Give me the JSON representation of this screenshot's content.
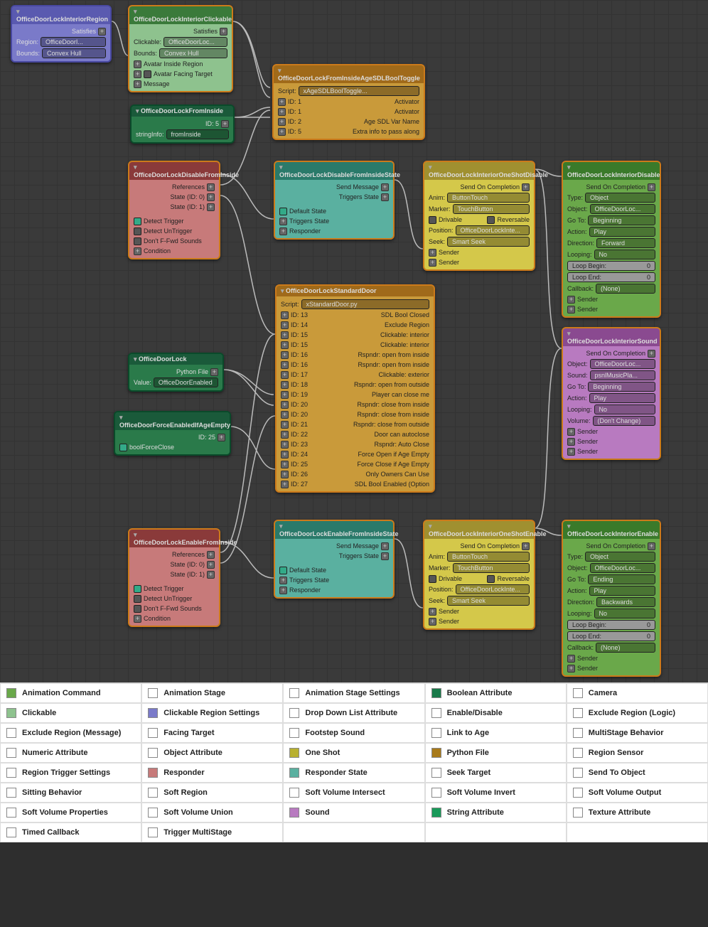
{
  "nodes": {
    "region": {
      "title": "OfficeDoorLockInteriorRegion",
      "satisfies": "Satisfies",
      "region_lbl": "Region:",
      "region_val": "OfficeDoorI...",
      "bounds_lbl": "Bounds:",
      "bounds_val": "Convex Hull"
    },
    "clickable": {
      "title": "OfficeDoorLockInteriorClickable",
      "satisfies": "Satisfies",
      "click_lbl": "Clickable:",
      "click_val": "OfficeDoorLoc...",
      "bounds_lbl": "Bounds:",
      "bounds_val": "Convex Hull",
      "avatar_inside": "Avatar Inside Region",
      "avatar_facing": "Avatar Facing Target",
      "message": "Message"
    },
    "fromInside": {
      "title": "OfficeDoorLockFromInside",
      "id_lbl": "ID: 5",
      "string_lbl": "stringInfo:",
      "string_val": "fromInside"
    },
    "ageToggle": {
      "title": "OfficeDoorLockFromInsideAgeSDLBoolToggle",
      "script_lbl": "Script:",
      "script_val": "xAgeSDLBoolToggle...",
      "rows": [
        {
          "id": "ID: 1",
          "txt": "Activator"
        },
        {
          "id": "ID: 1",
          "txt": "Activator"
        },
        {
          "id": "ID: 2",
          "txt": "Age SDL Var Name"
        },
        {
          "id": "ID: 5",
          "txt": "Extra info to pass along"
        }
      ]
    },
    "disable": {
      "title": "OfficeDoorLockDisableFromInside",
      "refs": "References",
      "s0": "State (ID: 0)",
      "s1": "State (ID: 1)",
      "det_trig": "Detect Trigger",
      "det_untrig": "Detect UnTrigger",
      "ffwd": "Don't F-Fwd Sounds",
      "cond": "Condition"
    },
    "disableState": {
      "title": "OfficeDoorLockDisableFromInsideState",
      "send": "Send Message",
      "trig": "Triggers State",
      "def": "Default State",
      "trig2": "Triggers State",
      "resp": "Responder"
    },
    "oneshotD": {
      "title": "OfficeDoorLockInteriorOneShotDisable",
      "comp": "Send On Completion",
      "anim_lbl": "Anim:",
      "anim_val": "ButtonTouch",
      "mark_lbl": "Marker:",
      "mark_val": "TouchButton",
      "driv": "Drivable",
      "rev": "Reversable",
      "pos_lbl": "Position:",
      "pos_val": "OfficeDoorLockInte...",
      "seek_lbl": "Seek:",
      "seek_val": "Smart Seek",
      "sender": "Sender"
    },
    "intDisable": {
      "title": "OfficeDoorLockInteriorDisable",
      "comp": "Send On Completion",
      "type_lbl": "Type:",
      "type_val": "Object",
      "obj_lbl": "Object:",
      "obj_val": "OfficeDoorLoc...",
      "goto_lbl": "Go To:",
      "goto_val": "Beginning",
      "act_lbl": "Action:",
      "act_val": "Play",
      "dir_lbl": "Direction:",
      "dir_val": "Forward",
      "loop_lbl": "Looping:",
      "loop_val": "No",
      "lb_lbl": "Loop Begin:",
      "lb_val": "0",
      "le_lbl": "Loop End:",
      "le_val": "0",
      "cb_lbl": "Callback:",
      "cb_val": "(None)",
      "sender": "Sender"
    },
    "lock": {
      "title": "OfficeDoorLock",
      "py": "Python File",
      "val_lbl": "Value:",
      "val": "OfficeDoorEnabled"
    },
    "forceEn": {
      "title": "OfficeDoorForceEnabledIfAgeEmpty",
      "id": "ID: 25",
      "bfc": "boolForceClose"
    },
    "stdDoor": {
      "title": "OfficeDoorLockStandardDoor",
      "script_lbl": "Script:",
      "script_val": "xStandardDoor.py",
      "rows": [
        {
          "id": "ID: 13",
          "txt": "SDL Bool Closed"
        },
        {
          "id": "ID: 14",
          "txt": "Exclude Region"
        },
        {
          "id": "ID: 15",
          "txt": "Clickable: interior"
        },
        {
          "id": "ID: 15",
          "txt": "Clickable: interior"
        },
        {
          "id": "ID: 16",
          "txt": "Rspndr: open from inside"
        },
        {
          "id": "ID: 16",
          "txt": "Rspndr: open from inside"
        },
        {
          "id": "ID: 17",
          "txt": "Clickable: exterior"
        },
        {
          "id": "ID: 18",
          "txt": "Rspndr: open from outside"
        },
        {
          "id": "ID: 19",
          "txt": "Player can close me"
        },
        {
          "id": "ID: 20",
          "txt": "Rspndr: close from inside"
        },
        {
          "id": "ID: 20",
          "txt": "Rspndr: close from inside"
        },
        {
          "id": "ID: 21",
          "txt": "Rspndr: close from outside"
        },
        {
          "id": "ID: 22",
          "txt": "Door can autoclose"
        },
        {
          "id": "ID: 23",
          "txt": "Rspndr: Auto Close"
        },
        {
          "id": "ID: 24",
          "txt": "Force Open if Age Empty"
        },
        {
          "id": "ID: 25",
          "txt": "Force Close if Age Empty"
        },
        {
          "id": "ID: 26",
          "txt": "Only Owners Can Use"
        },
        {
          "id": "ID: 27",
          "txt": "SDL Bool Enabled (Option"
        }
      ]
    },
    "enable": {
      "title": "OfficeDoorLockEnableFromInside",
      "refs": "References",
      "s0": "State (ID: 0)",
      "s1": "State (ID: 1)",
      "det_trig": "Detect Trigger",
      "det_untrig": "Detect UnTrigger",
      "ffwd": "Don't F-Fwd Sounds",
      "cond": "Condition"
    },
    "enableState": {
      "title": "OfficeDoorLockEnableFromInsideState",
      "send": "Send Message",
      "trig": "Triggers State",
      "def": "Default State",
      "trig2": "Triggers State",
      "resp": "Responder"
    },
    "oneshotE": {
      "title": "OfficeDoorLockInteriorOneShotEnable",
      "comp": "Send On Completion",
      "anim_lbl": "Anim:",
      "anim_val": "ButtonTouch",
      "mark_lbl": "Marker:",
      "mark_val": "TouchButton",
      "driv": "Drivable",
      "rev": "Reversable",
      "pos_lbl": "Position:",
      "pos_val": "OfficeDoorLockInte...",
      "seek_lbl": "Seek:",
      "seek_val": "Smart Seek",
      "sender": "Sender"
    },
    "sound": {
      "title": "OfficeDoorLockInteriorSound",
      "comp": "Send On Completion",
      "obj_lbl": "Object:",
      "obj_val": "OfficeDoorLoc...",
      "snd_lbl": "Sound:",
      "snd_val": "psnlMusicPla...",
      "goto_lbl": "Go To:",
      "goto_val": "Beginning",
      "act_lbl": "Action:",
      "act_val": "Play",
      "loop_lbl": "Looping:",
      "loop_val": "No",
      "vol_lbl": "Volume:",
      "vol_val": "(Don't Change)",
      "sender": "Sender"
    },
    "intEnable": {
      "title": "OfficeDoorLockInteriorEnable",
      "comp": "Send On Completion",
      "type_lbl": "Type:",
      "type_val": "Object",
      "obj_lbl": "Object:",
      "obj_val": "OfficeDoorLoc...",
      "goto_lbl": "Go To:",
      "goto_val": "Ending",
      "act_lbl": "Action:",
      "act_val": "Play",
      "dir_lbl": "Direction:",
      "dir_val": "Backwards",
      "loop_lbl": "Looping:",
      "loop_val": "No",
      "lb_lbl": "Loop Begin:",
      "lb_val": "0",
      "le_lbl": "Loop End:",
      "le_val": "0",
      "cb_lbl": "Callback:",
      "cb_val": "(None)",
      "sender": "Sender"
    }
  },
  "legend": [
    {
      "c": "#6aa84a",
      "t": "Animation Command"
    },
    {
      "c": "#fff",
      "t": "Animation Stage"
    },
    {
      "c": "#fff",
      "t": "Animation Stage Settings"
    },
    {
      "c": "#1a7a4a",
      "t": "Boolean Attribute"
    },
    {
      "c": "#fff",
      "t": "Camera"
    },
    {
      "c": "#8ec28e",
      "t": "Clickable"
    },
    {
      "c": "#7a7ac9",
      "t": "Clickable Region Settings"
    },
    {
      "c": "#fff",
      "t": "Drop Down List Attribute"
    },
    {
      "c": "#fff",
      "t": "Enable/Disable"
    },
    {
      "c": "#fff",
      "t": "Exclude Region (Logic)"
    },
    {
      "c": "#fff",
      "t": "Exclude Region (Message)"
    },
    {
      "c": "#fff",
      "t": "Facing Target"
    },
    {
      "c": "#fff",
      "t": "Footstep Sound"
    },
    {
      "c": "#fff",
      "t": "Link to Age"
    },
    {
      "c": "#fff",
      "t": "MultiStage Behavior"
    },
    {
      "c": "#fff",
      "t": "Numeric Attribute"
    },
    {
      "c": "#fff",
      "t": "Object Attribute"
    },
    {
      "c": "#b8b030",
      "t": "One Shot"
    },
    {
      "c": "#a87a1a",
      "t": "Python File"
    },
    {
      "c": "#fff",
      "t": "Region Sensor"
    },
    {
      "c": "#fff",
      "t": "Region Trigger Settings"
    },
    {
      "c": "#c77a7a",
      "t": "Responder"
    },
    {
      "c": "#5ab0a0",
      "t": "Responder State"
    },
    {
      "c": "#fff",
      "t": "Seek Target"
    },
    {
      "c": "#fff",
      "t": "Send To Object"
    },
    {
      "c": "#fff",
      "t": "Sitting Behavior"
    },
    {
      "c": "#fff",
      "t": "Soft Region"
    },
    {
      "c": "#fff",
      "t": "Soft Volume Intersect"
    },
    {
      "c": "#fff",
      "t": "Soft Volume Invert"
    },
    {
      "c": "#fff",
      "t": "Soft Volume Output"
    },
    {
      "c": "#fff",
      "t": "Soft Volume Properties"
    },
    {
      "c": "#fff",
      "t": "Soft Volume Union"
    },
    {
      "c": "#b87ac0",
      "t": "Sound"
    },
    {
      "c": "#1a9a5a",
      "t": "String Attribute"
    },
    {
      "c": "#fff",
      "t": "Texture Attribute"
    },
    {
      "c": "#fff",
      "t": "Timed Callback"
    },
    {
      "c": "#fff",
      "t": "Trigger MultiStage"
    },
    {
      "c": "",
      "t": ""
    },
    {
      "c": "",
      "t": ""
    },
    {
      "c": "",
      "t": ""
    }
  ]
}
